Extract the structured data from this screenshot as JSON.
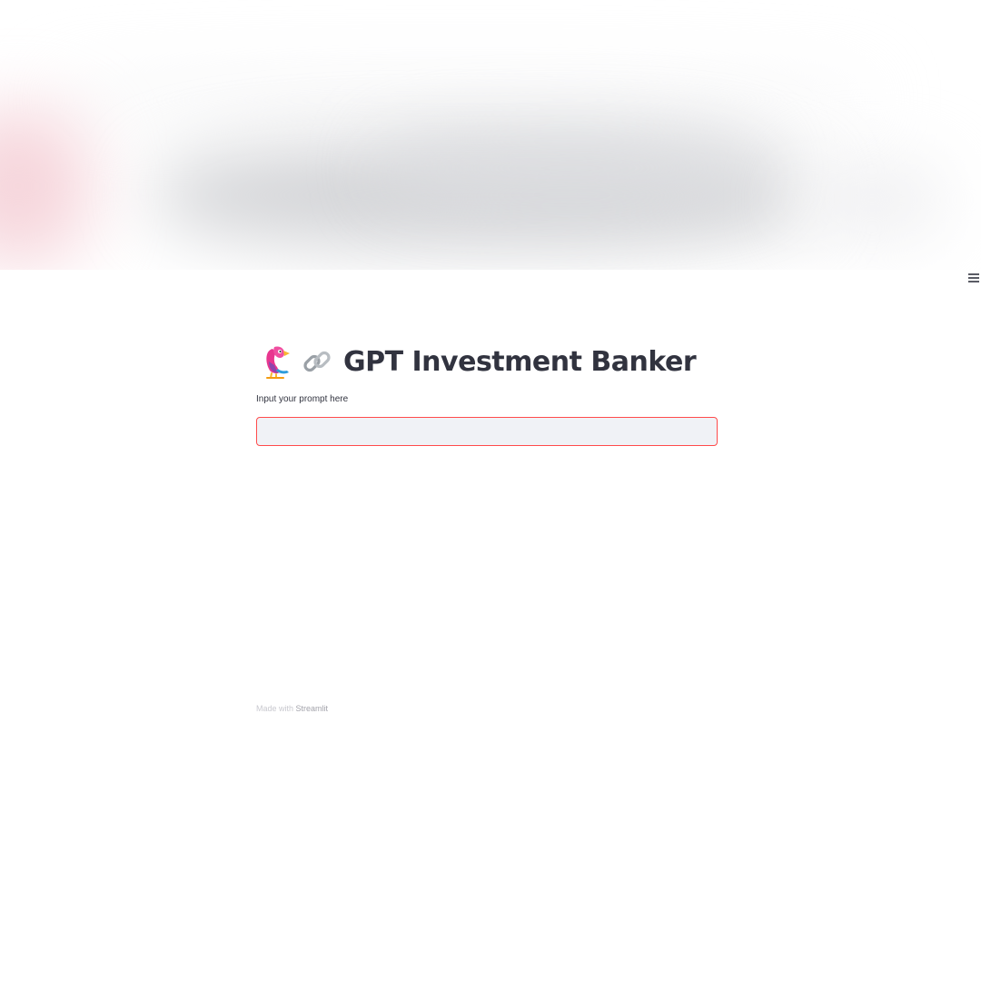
{
  "header": {
    "menu_icon": "hamburger-menu-icon"
  },
  "main": {
    "title_icons": [
      "parrot-icon",
      "link-icon"
    ],
    "title": "GPT Investment Banker",
    "prompt_label": "Input your prompt here",
    "prompt_value": ""
  },
  "footer": {
    "prefix": "Made with",
    "brand": "Streamlit"
  },
  "colors": {
    "accent": "#ff4b4b",
    "text": "#31333f",
    "input_bg": "#f0f2f6"
  }
}
